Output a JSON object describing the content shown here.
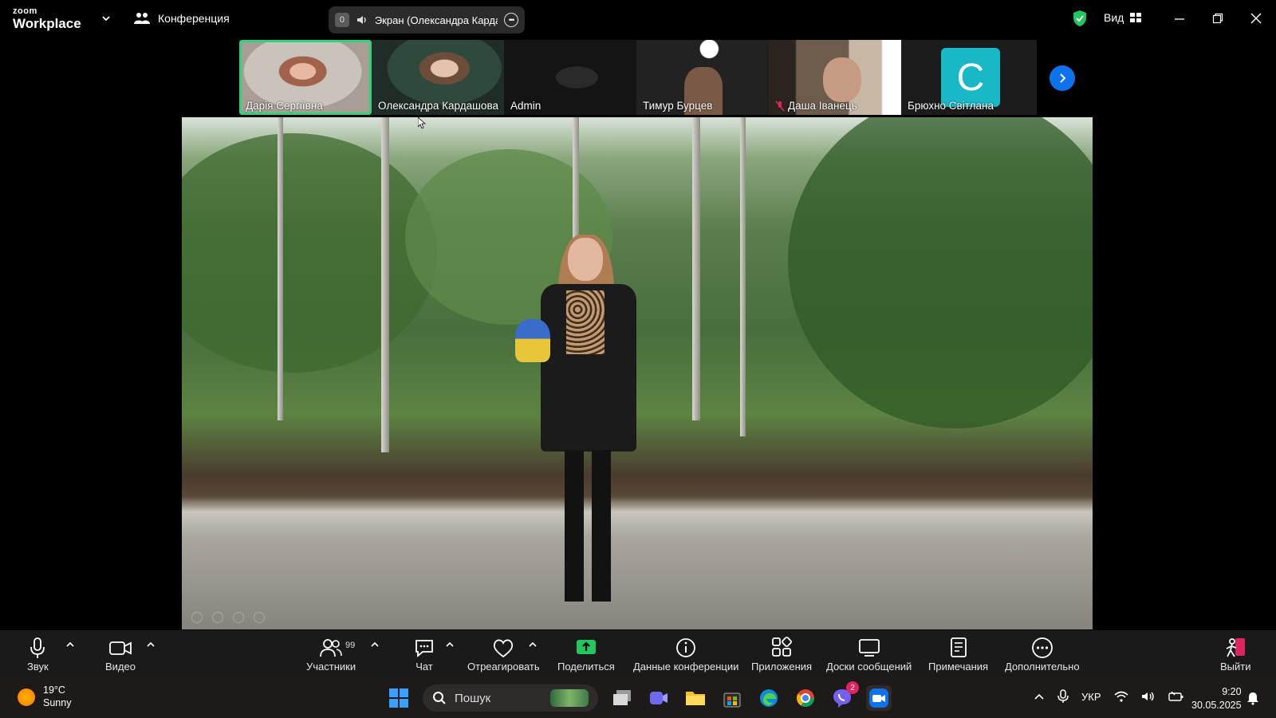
{
  "app": {
    "logo_small": "zoom",
    "logo_big": "Workplace",
    "meeting_label": "Конференция",
    "screen_badge": "0",
    "screen_share_title": "Экран (Олександра Кардашова)",
    "view_label": "Вид"
  },
  "participants": [
    {
      "name": "Дарія Сергіївна",
      "active": true
    },
    {
      "name": "Олександра Кардашова",
      "active": false
    },
    {
      "name": "Admin",
      "active": false
    },
    {
      "name": "Тимур Бурцев",
      "active": false
    },
    {
      "name": "Даша Іванець",
      "muted": true
    },
    {
      "name": "Брюхно Світлана",
      "avatar_letter": "C"
    }
  ],
  "toolbar": {
    "audio": "Звук",
    "video": "Видео",
    "participants": "Участники",
    "participants_count": "99",
    "chat": "Чат",
    "react": "Отреагировать",
    "share": "Поделиться",
    "meeting_info": "Данные конференции",
    "apps": "Приложения",
    "whiteboards": "Доски сообщений",
    "notes": "Примечания",
    "more": "Дополнительно",
    "leave": "Выйти"
  },
  "taskbar": {
    "weather_temp": "19°C",
    "weather_desc": "Sunny",
    "search_placeholder": "Пошук",
    "viber_badge": "2",
    "language": "УКР",
    "time": "9:20",
    "date": "30.05.2025"
  },
  "colors": {
    "active_green": "#33d17a",
    "zoom_blue": "#0e72ed",
    "share_green": "#22c55e",
    "leave_red": "#e0245e"
  }
}
